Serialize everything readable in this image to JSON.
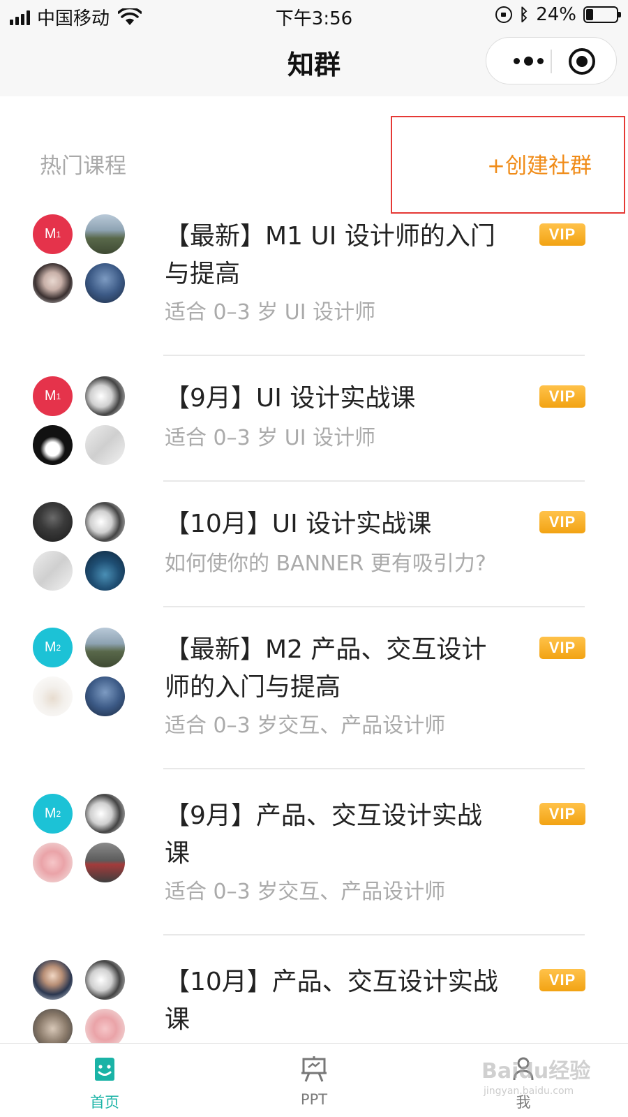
{
  "status_bar": {
    "carrier": "中国移动",
    "time": "下午3:56",
    "battery_text": "24%",
    "battery_level": 0.24,
    "icons": [
      "signal-icon",
      "wifi-icon",
      "rotation-lock-icon",
      "bluetooth-icon",
      "battery-icon"
    ]
  },
  "nav": {
    "title": "知群",
    "capsule_icons": [
      "more-icon",
      "close-target-icon"
    ]
  },
  "section": {
    "title": "热门课程",
    "create_label": "+创建社群",
    "highlight_color": "#e53935",
    "accent_color": "#f08c19"
  },
  "courses": [
    {
      "title": "【最新】M1 UI 设计师的入门与提高",
      "subtitle": "适合 0–3 岁 UI 设计师",
      "badge": "VIP"
    },
    {
      "title": "【9月】UI 设计实战课",
      "subtitle": "适合 0–3 岁 UI 设计师",
      "badge": "VIP"
    },
    {
      "title": "【10月】UI 设计实战课",
      "subtitle": "如何使你的 BANNER 更有吸引力?",
      "badge": "VIP"
    },
    {
      "title": "【最新】M2 产品、交互设计师的入门与提高",
      "subtitle": "适合 0–3 岁交互、产品设计师",
      "badge": "VIP"
    },
    {
      "title": "【9月】产品、交互设计实战课",
      "subtitle": "适合 0–3 岁交互、产品设计师",
      "badge": "VIP"
    },
    {
      "title": "【10月】产品、交互设计实战课",
      "subtitle": "",
      "badge": "VIP"
    }
  ],
  "avatar_badges": {
    "m1": "M",
    "m1_sub": "1",
    "m2": "M",
    "m2_sub": "2"
  },
  "tabs": [
    {
      "label": "首页",
      "icon": "home-face-icon",
      "active": true
    },
    {
      "label": "PPT",
      "icon": "ppt-easel-icon",
      "active": false
    },
    {
      "label": "我",
      "icon": "profile-icon",
      "active": false
    }
  ],
  "watermark": {
    "text": "Baidu经验",
    "url": "jingyan.baidu.com"
  },
  "colors": {
    "vip": "#f2a313",
    "active_tab": "#1ab3a6",
    "m1_red": "#e5334b",
    "m2_cyan": "#1cc2d6"
  }
}
